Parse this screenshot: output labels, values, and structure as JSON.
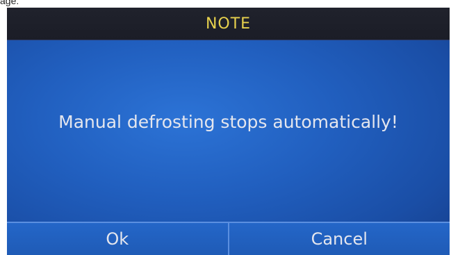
{
  "caption": "age:",
  "dialog": {
    "title": "NOTE",
    "message": "Manual defrosting stops automatically!",
    "buttons": {
      "ok": "Ok",
      "cancel": "Cancel"
    }
  },
  "colors": {
    "title_bar_bg": "#1b1d27",
    "title_text": "#e7d14d",
    "screen_bg": "#215fbf",
    "button_border": "#5b8fe0",
    "text": "#e4e6ee"
  }
}
